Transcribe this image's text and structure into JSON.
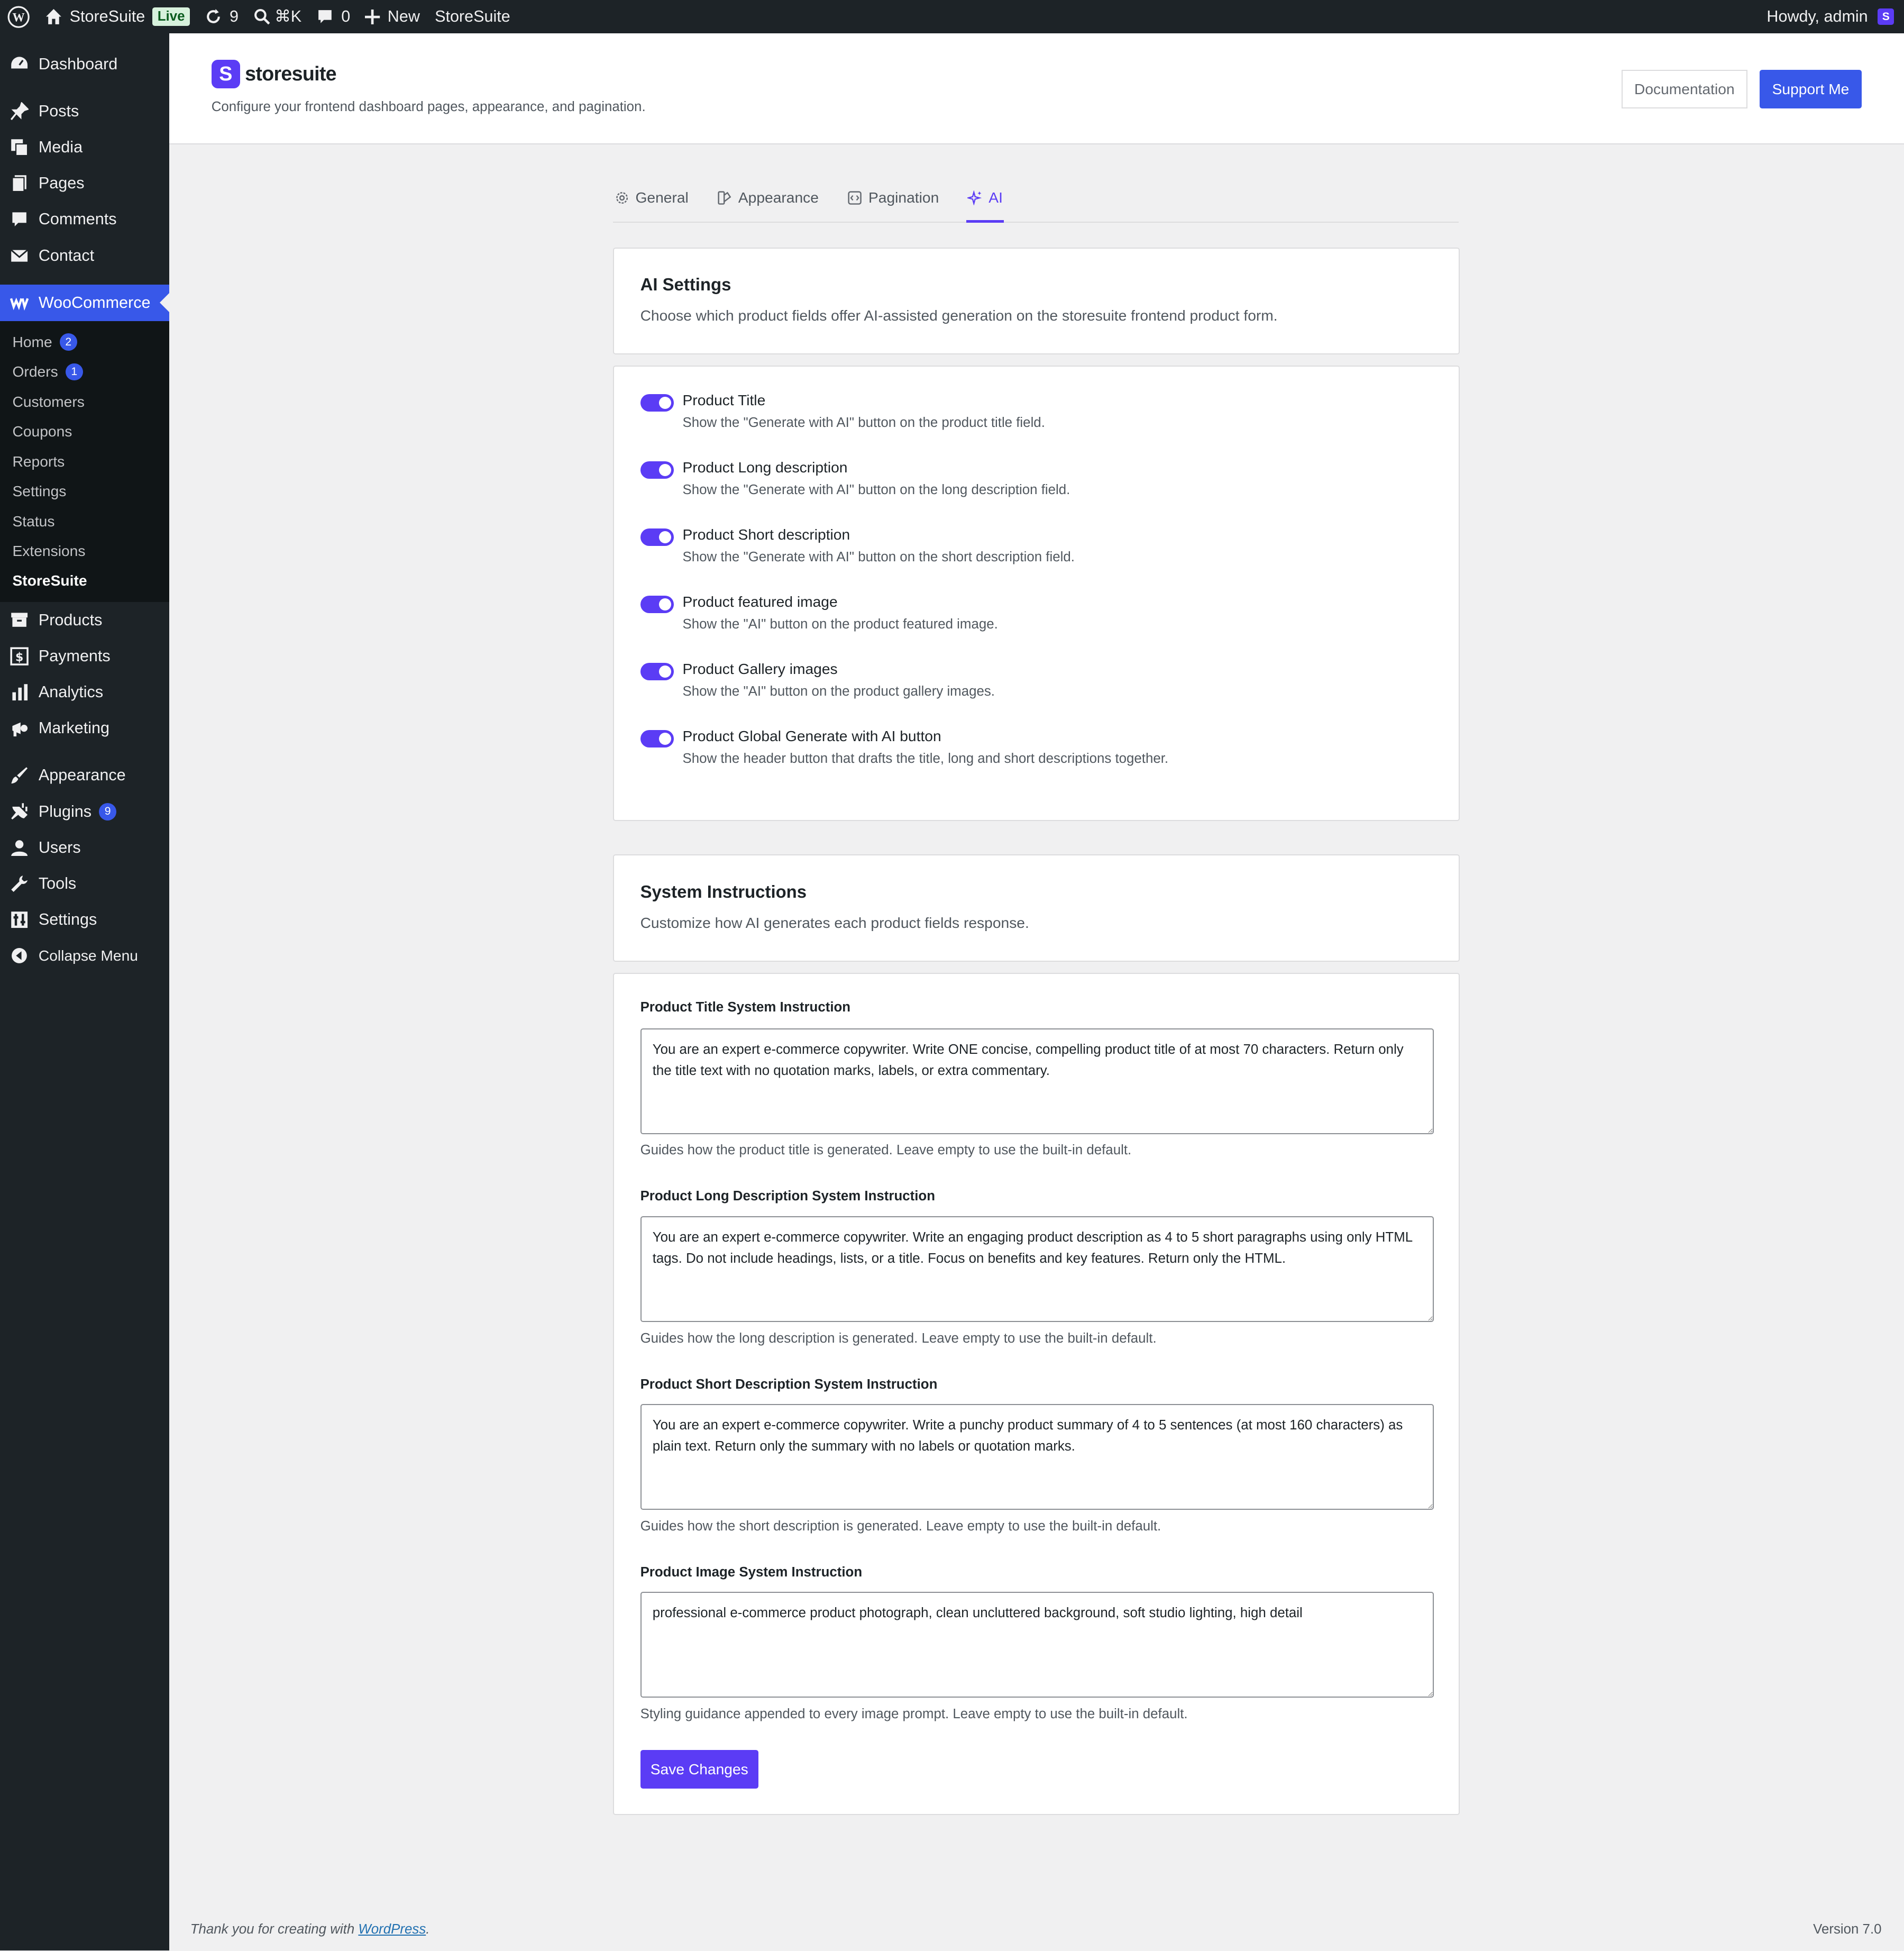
{
  "adminbar": {
    "site_name": "StoreSuite",
    "live_badge": "Live",
    "updates_count": "9",
    "search_shortcut": "⌘K",
    "comments_count": "0",
    "new_label": "New",
    "plugin_link": "StoreSuite",
    "greeting": "Howdy, admin",
    "avatar_letter": "S"
  },
  "sidebar": {
    "top_items": [
      {
        "label": "Dashboard",
        "icon": "dashboard-icon"
      },
      {
        "label": "Posts",
        "icon": "pin-icon"
      },
      {
        "label": "Media",
        "icon": "media-icon"
      },
      {
        "label": "Pages",
        "icon": "pages-icon"
      },
      {
        "label": "Comments",
        "icon": "comment-icon"
      },
      {
        "label": "Contact",
        "icon": "mail-icon"
      }
    ],
    "woocommerce": {
      "label": "WooCommerce",
      "icon": "woo-icon"
    },
    "woo_submenu": [
      {
        "label": "Home",
        "count": "2"
      },
      {
        "label": "Orders",
        "count": "1"
      },
      {
        "label": "Customers"
      },
      {
        "label": "Coupons"
      },
      {
        "label": "Reports"
      },
      {
        "label": "Settings"
      },
      {
        "label": "Status"
      },
      {
        "label": "Extensions"
      },
      {
        "label": "StoreSuite"
      }
    ],
    "commerce_items": [
      {
        "label": "Products",
        "icon": "archive-icon"
      },
      {
        "label": "Payments",
        "icon": "dollar-icon"
      },
      {
        "label": "Analytics",
        "icon": "bar-chart-icon"
      },
      {
        "label": "Marketing",
        "icon": "megaphone-icon"
      }
    ],
    "admin_items": [
      {
        "label": "Appearance",
        "icon": "brush-icon"
      },
      {
        "label": "Plugins",
        "icon": "plug-icon",
        "count": "9"
      },
      {
        "label": "Users",
        "icon": "user-icon"
      },
      {
        "label": "Tools",
        "icon": "wrench-icon"
      },
      {
        "label": "Settings",
        "icon": "settings-icon"
      },
      {
        "label": "Collapse Menu",
        "icon": "collapse-icon"
      }
    ]
  },
  "header": {
    "logo_letter": "S",
    "logo_text": "storesuite",
    "description": "Configure your frontend dashboard pages, appearance, and pagination.",
    "documentation_label": "Documentation",
    "support_label": "Support Me"
  },
  "tabs": [
    {
      "label": "General",
      "icon": "gear-icon"
    },
    {
      "label": "Appearance",
      "icon": "palette-icon"
    },
    {
      "label": "Pagination",
      "icon": "pagination-icon"
    },
    {
      "label": "AI",
      "icon": "sparkle-icon",
      "active": true
    }
  ],
  "ai_settings": {
    "title": "AI Settings",
    "description": "Choose which product fields offer AI-assisted generation on the storesuite frontend product form.",
    "toggles": [
      {
        "label": "Product Title",
        "help": "Show the \"Generate with AI\" button on the product title field.",
        "enabled": true
      },
      {
        "label": "Product Long description",
        "help": "Show the \"Generate with AI\" button on the long description field.",
        "enabled": true
      },
      {
        "label": "Product Short description",
        "help": "Show the \"Generate with AI\" button on the short description field.",
        "enabled": true
      },
      {
        "label": "Product featured image",
        "help": "Show the \"AI\" button on the product featured image.",
        "enabled": true
      },
      {
        "label": "Product Gallery images",
        "help": "Show the \"AI\" button on the product gallery images.",
        "enabled": true
      },
      {
        "label": "Product Global Generate with AI button",
        "help": "Show the header button that drafts the title, long and short descriptions together.",
        "enabled": true
      }
    ]
  },
  "system_instructions": {
    "title": "System Instructions",
    "description": "Customize how AI generates each product fields response.",
    "fields": [
      {
        "label": "Product Title System Instruction",
        "value": "You are an expert e-commerce copywriter. Write ONE concise, compelling product title of at most 70 characters. Return only the title text with no quotation marks, labels, or extra commentary.",
        "help": "Guides how the product title is generated. Leave empty to use the built-in default."
      },
      {
        "label": "Product Long Description System Instruction",
        "value": "You are an expert e-commerce copywriter. Write an engaging product description as 4 to 5 short paragraphs using only HTML tags. Do not include headings, lists, or a title. Focus on benefits and key features. Return only the HTML.",
        "help": "Guides how the long description is generated. Leave empty to use the built-in default."
      },
      {
        "label": "Product Short Description System Instruction",
        "value": "You are an expert e-commerce copywriter. Write a punchy product summary of 4 to 5 sentences (at most 160 characters) as plain text. Return only the summary with no labels or quotation marks.",
        "help": "Guides how the short description is generated. Leave empty to use the built-in default."
      },
      {
        "label": "Product Image System Instruction",
        "value": "professional e-commerce product photograph, clean uncluttered background, soft studio lighting, high detail",
        "help": "Styling guidance appended to every image prompt. Leave empty to use the built-in default."
      }
    ],
    "save_label": "Save Changes"
  },
  "footer": {
    "thanks_prefix": "Thank you for creating with ",
    "wordpress_link": "WordPress",
    "thanks_suffix": ".",
    "version": "Version 7.0"
  },
  "colors": {
    "accent": "#5b3cf5",
    "wp_blue": "#3858e9",
    "admin_dark": "#1d2327"
  }
}
